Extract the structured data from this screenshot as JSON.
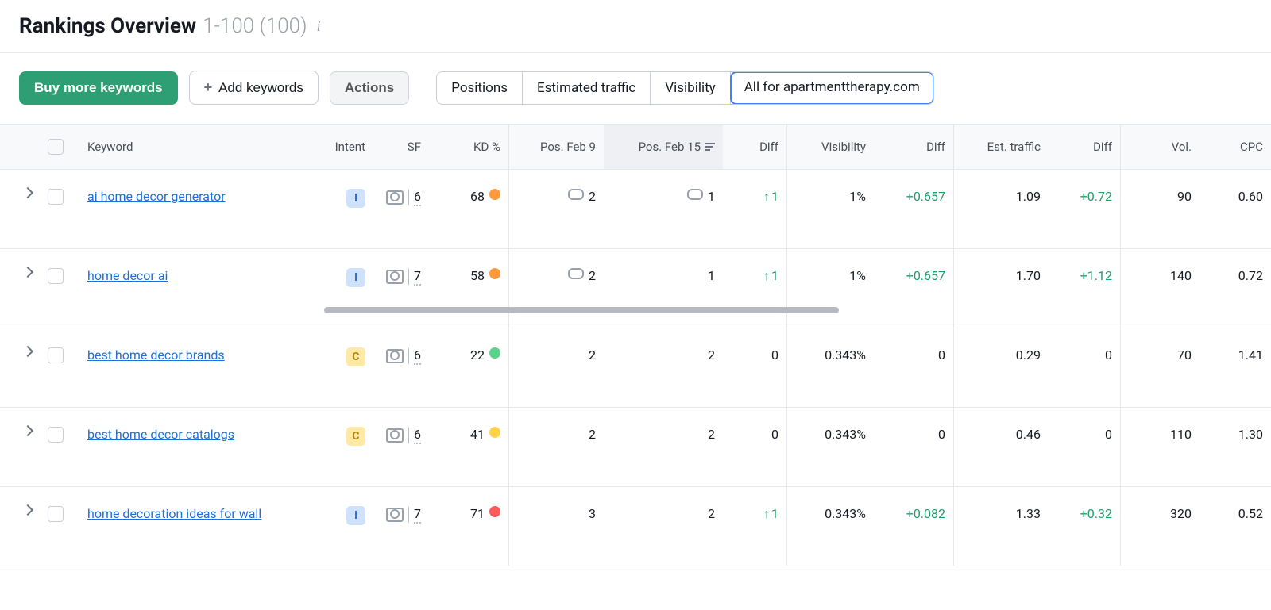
{
  "header": {
    "title": "Rankings Overview",
    "range": "1-100 (100)"
  },
  "toolbar": {
    "buy_label": "Buy more keywords",
    "add_label": "Add keywords",
    "actions_label": "Actions",
    "tabs": [
      "Positions",
      "Estimated traffic",
      "Visibility",
      "All for apartmenttherapy.com"
    ],
    "active_tab_index": 3
  },
  "columns": {
    "keyword": "Keyword",
    "intent": "Intent",
    "sf": "SF",
    "kd": "KD %",
    "pos1": "Pos. Feb 9",
    "pos2": "Pos. Feb 15",
    "diff1": "Diff",
    "visibility": "Visibility",
    "diff2": "Diff",
    "est": "Est. traffic",
    "diff3": "Diff",
    "vol": "Vol.",
    "cpc": "CPC"
  },
  "rows": [
    {
      "keyword": "ai home decor generator",
      "intent": "I",
      "sf": "6",
      "kd": "68",
      "kd_color": "orange",
      "pos1_link": true,
      "pos1": "2",
      "pos2_link": true,
      "pos2": "1",
      "diff1_up": true,
      "diff1": "1",
      "visibility": "1%",
      "vis_diff": "+0.657",
      "vis_diff_up": true,
      "est": "1.09",
      "est_diff": "+0.72",
      "est_diff_up": true,
      "vol": "90",
      "cpc": "0.60"
    },
    {
      "keyword": "home decor ai",
      "intent": "I",
      "sf": "7",
      "kd": "58",
      "kd_color": "orange",
      "pos1_link": true,
      "pos1": "2",
      "pos2_link": false,
      "pos2": "1",
      "diff1_up": true,
      "diff1": "1",
      "visibility": "1%",
      "vis_diff": "+0.657",
      "vis_diff_up": true,
      "est": "1.70",
      "est_diff": "+1.12",
      "est_diff_up": true,
      "vol": "140",
      "cpc": "0.72"
    },
    {
      "keyword": "best home decor brands",
      "intent": "C",
      "sf": "6",
      "kd": "22",
      "kd_color": "green",
      "pos1_link": false,
      "pos1": "2",
      "pos2_link": false,
      "pos2": "2",
      "diff1_up": false,
      "diff1": "0",
      "visibility": "0.343%",
      "vis_diff": "0",
      "vis_diff_up": false,
      "est": "0.29",
      "est_diff": "0",
      "est_diff_up": false,
      "vol": "70",
      "cpc": "1.41"
    },
    {
      "keyword": "best home decor catalogs",
      "intent": "C",
      "sf": "6",
      "kd": "41",
      "kd_color": "yellow",
      "pos1_link": false,
      "pos1": "2",
      "pos2_link": false,
      "pos2": "2",
      "diff1_up": false,
      "diff1": "0",
      "visibility": "0.343%",
      "vis_diff": "0",
      "vis_diff_up": false,
      "est": "0.46",
      "est_diff": "0",
      "est_diff_up": false,
      "vol": "110",
      "cpc": "1.30"
    },
    {
      "keyword": "home decoration ideas for wall",
      "intent": "I",
      "sf": "7",
      "kd": "71",
      "kd_color": "red",
      "pos1_link": false,
      "pos1": "3",
      "pos2_link": false,
      "pos2": "2",
      "diff1_up": true,
      "diff1": "1",
      "visibility": "0.343%",
      "vis_diff": "+0.082",
      "vis_diff_up": true,
      "est": "1.33",
      "est_diff": "+0.32",
      "est_diff_up": true,
      "vol": "320",
      "cpc": "0.52"
    }
  ]
}
